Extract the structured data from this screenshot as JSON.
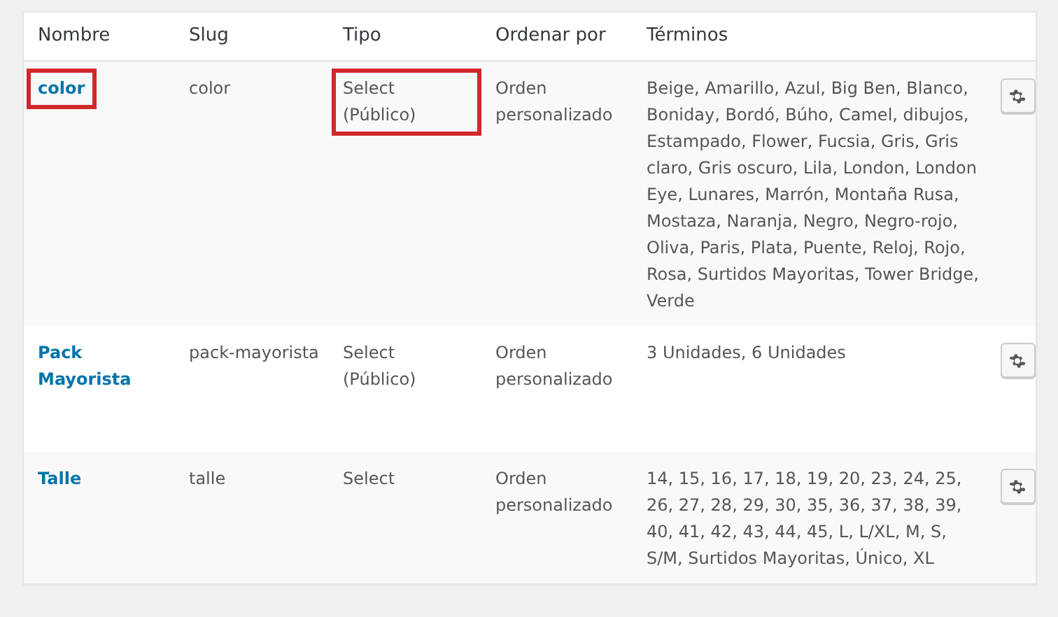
{
  "table": {
    "columns": [
      "Nombre",
      "Slug",
      "Tipo",
      "Ordenar por",
      "Términos"
    ],
    "rows": [
      {
        "name": "color",
        "slug": "color",
        "type": "Select (Público)",
        "order": "Orden personalizado",
        "terms": "Beige, Amarillo, Azul, Big Ben, Blanco, Boniday, Bordó, Búho, Camel, dibujos, Estampado, Flower, Fucsia, Gris, Gris claro, Gris oscuro, Lila, London, London Eye, Lunares, Marrón, Montaña Rusa, Mostaza, Naranja, Negro, Negro-rojo, Oliva, Paris, Plata, Puente, Reloj, Rojo, Rosa, Surtidos Mayoritas, Tower Bridge, Verde",
        "name_highlighted": true,
        "type_highlighted": true
      },
      {
        "name": "Pack Mayorista",
        "slug": "pack-mayorista",
        "type": "Select (Público)",
        "order": "Orden personalizado",
        "terms": "3 Unidades, 6 Unidades",
        "name_highlighted": false,
        "type_highlighted": false
      },
      {
        "name": "Talle",
        "slug": "talle",
        "type": "Select",
        "order": "Orden personalizado",
        "terms": "14, 15, 16, 17, 18, 19, 20, 23, 24, 25, 26, 27, 28, 29, 30, 35, 36, 37, 38, 39, 40, 41, 42, 43, 44, 45, L, L/XL, M, S, S/M, Surtidos Mayoritas, Único, XL",
        "name_highlighted": false,
        "type_highlighted": false
      }
    ]
  }
}
